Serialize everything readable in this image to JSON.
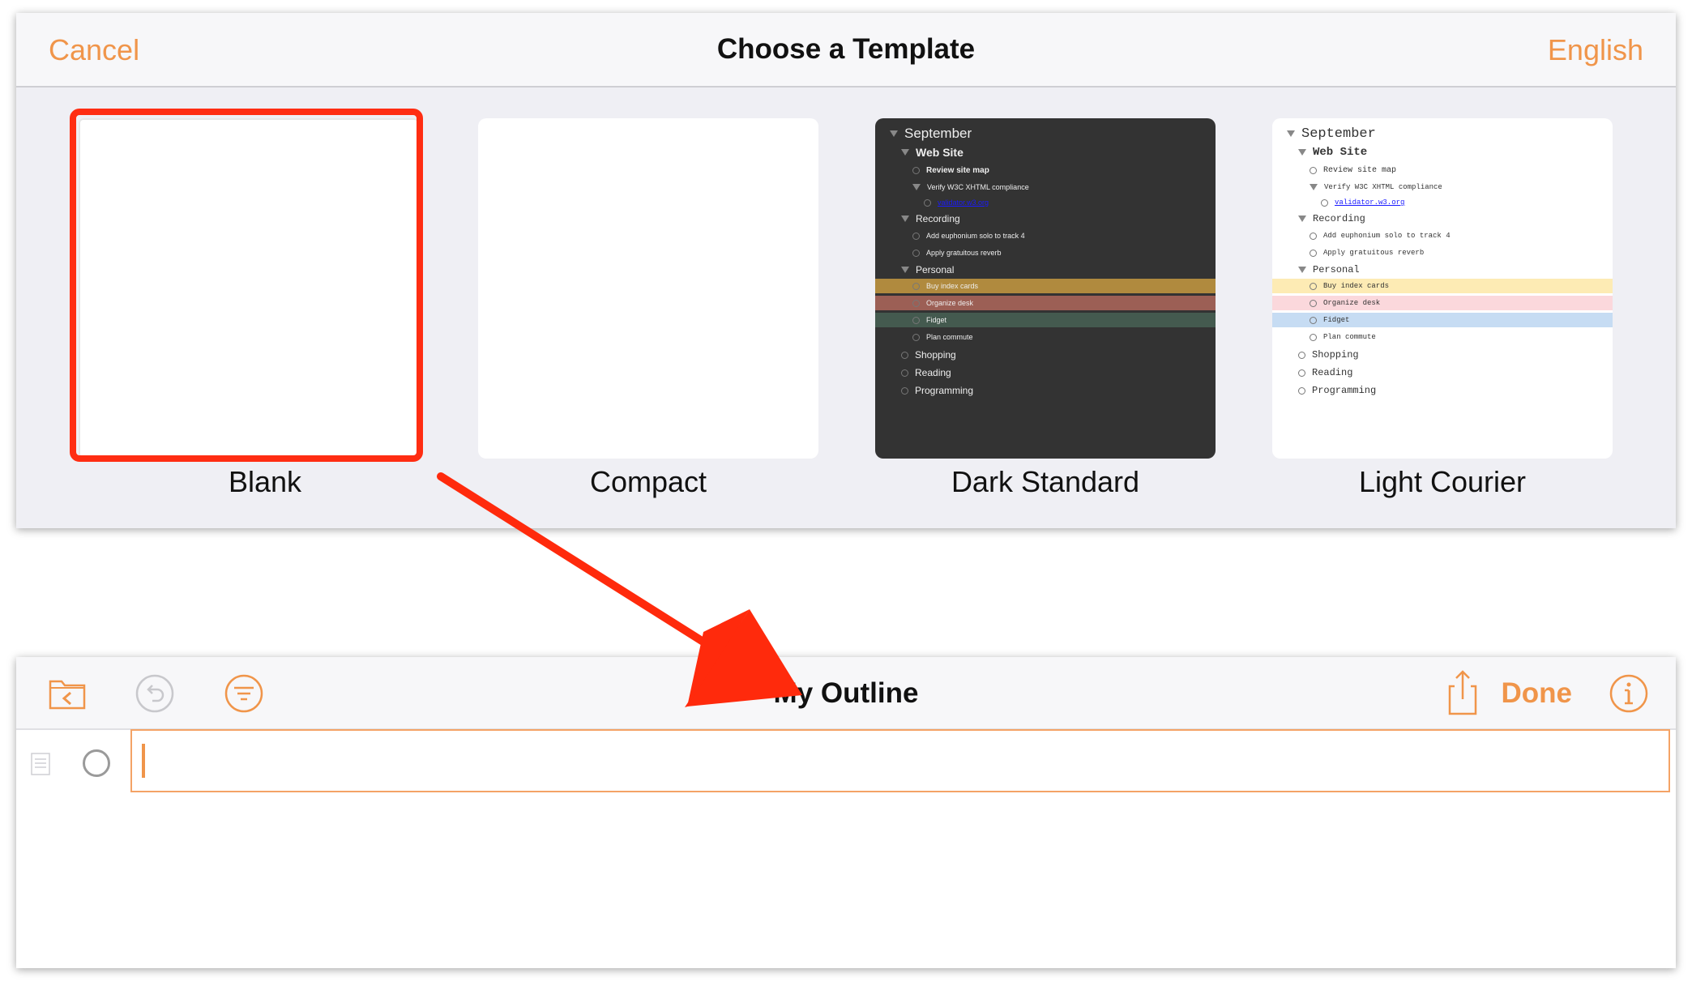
{
  "chooser": {
    "cancel_label": "Cancel",
    "title": "Choose a Template",
    "language_label": "English",
    "templates": [
      {
        "name": "Blank",
        "selected": true
      },
      {
        "name": "Compact",
        "selected": false
      },
      {
        "name": "Dark Standard",
        "selected": false
      },
      {
        "name": "Light Courier",
        "selected": false
      }
    ],
    "preview_rows": [
      {
        "text": "September",
        "level": 0,
        "marker": "triangle",
        "style": "title"
      },
      {
        "text": "Web Site",
        "level": 1,
        "marker": "triangle",
        "style": "heading"
      },
      {
        "text": "Review site map",
        "level": 2,
        "marker": "circle",
        "style": "bold-small"
      },
      {
        "text": "Verify W3C XHTML compliance",
        "level": 2,
        "marker": "triangle",
        "style": "small"
      },
      {
        "text": "validator.w3.org",
        "level": 3,
        "marker": "circle",
        "style": "link"
      },
      {
        "text": "Recording",
        "level": 1,
        "marker": "triangle",
        "style": "normal"
      },
      {
        "text": "Add euphonium solo to track 4",
        "level": 2,
        "marker": "circle",
        "style": "small"
      },
      {
        "text": "Apply gratuitous reverb",
        "level": 2,
        "marker": "circle",
        "style": "small"
      },
      {
        "text": "Personal",
        "level": 1,
        "marker": "triangle",
        "style": "normal"
      },
      {
        "text": "Buy index cards",
        "level": 2,
        "marker": "circle",
        "style": "small",
        "highlight": "yellow"
      },
      {
        "text": "Organize desk",
        "level": 2,
        "marker": "circle",
        "style": "small",
        "highlight": "red"
      },
      {
        "text": "Fidget",
        "level": 2,
        "marker": "circle",
        "style": "small",
        "highlight": "blue"
      },
      {
        "text": "Plan commute",
        "level": 2,
        "marker": "circle",
        "style": "small"
      },
      {
        "text": "Shopping",
        "level": 1,
        "marker": "circle",
        "style": "normal"
      },
      {
        "text": "Reading",
        "level": 1,
        "marker": "circle",
        "style": "normal"
      },
      {
        "text": "Programming",
        "level": 1,
        "marker": "circle",
        "style": "normal"
      }
    ]
  },
  "editor": {
    "title": "My Outline",
    "done_label": "Done",
    "icons": [
      "folder-back-icon",
      "undo-icon",
      "filter-icon",
      "share-icon",
      "info-icon"
    ],
    "row_value": ""
  },
  "colors": {
    "accent": "#f0954a",
    "selection": "#ff2d12",
    "arrow": "#ff2a0c"
  }
}
